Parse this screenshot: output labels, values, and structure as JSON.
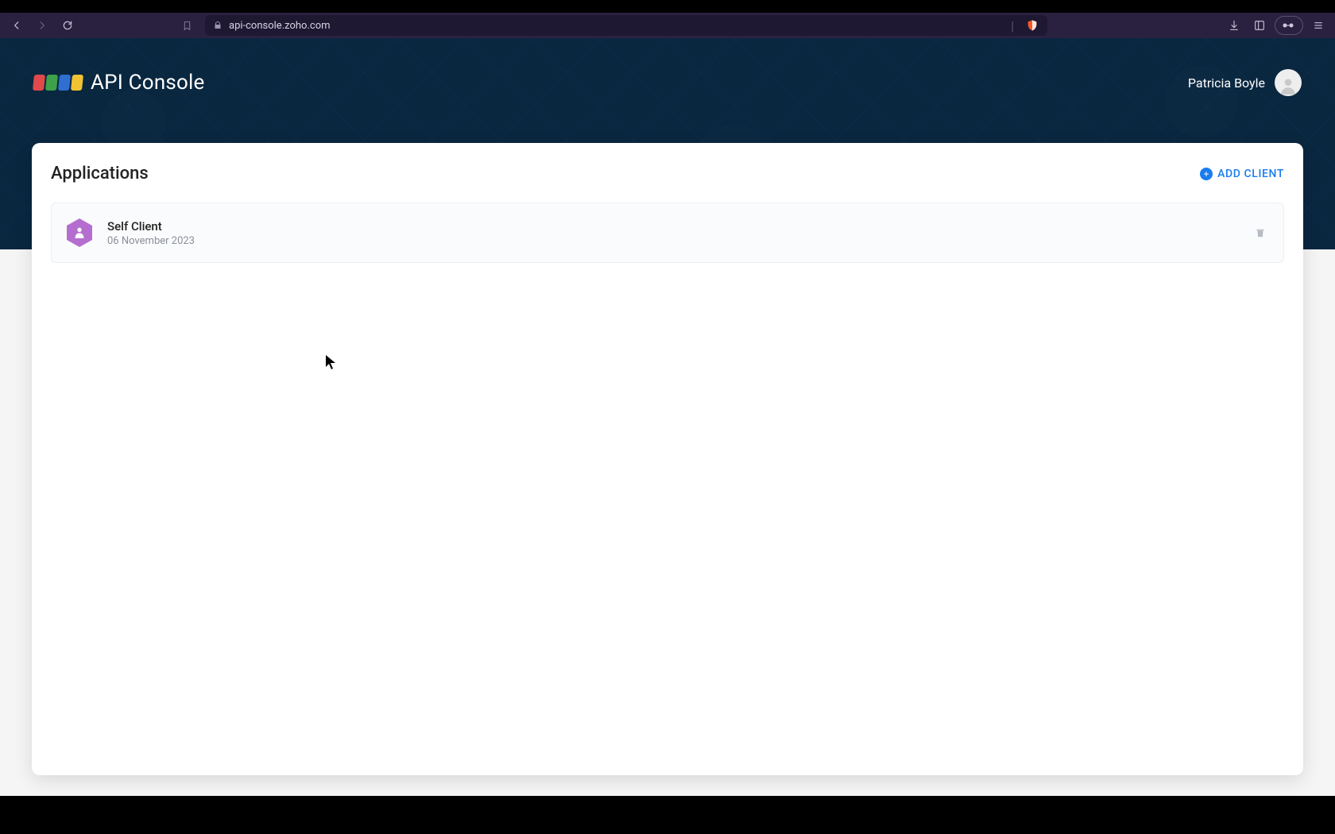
{
  "browser": {
    "url": "api-console.zoho.com"
  },
  "header": {
    "product": "API Console",
    "user_name": "Patricia Boyle"
  },
  "main": {
    "title": "Applications",
    "add_label": "ADD CLIENT",
    "applications": [
      {
        "name": "Self Client",
        "date": "06 November 2023"
      }
    ]
  }
}
